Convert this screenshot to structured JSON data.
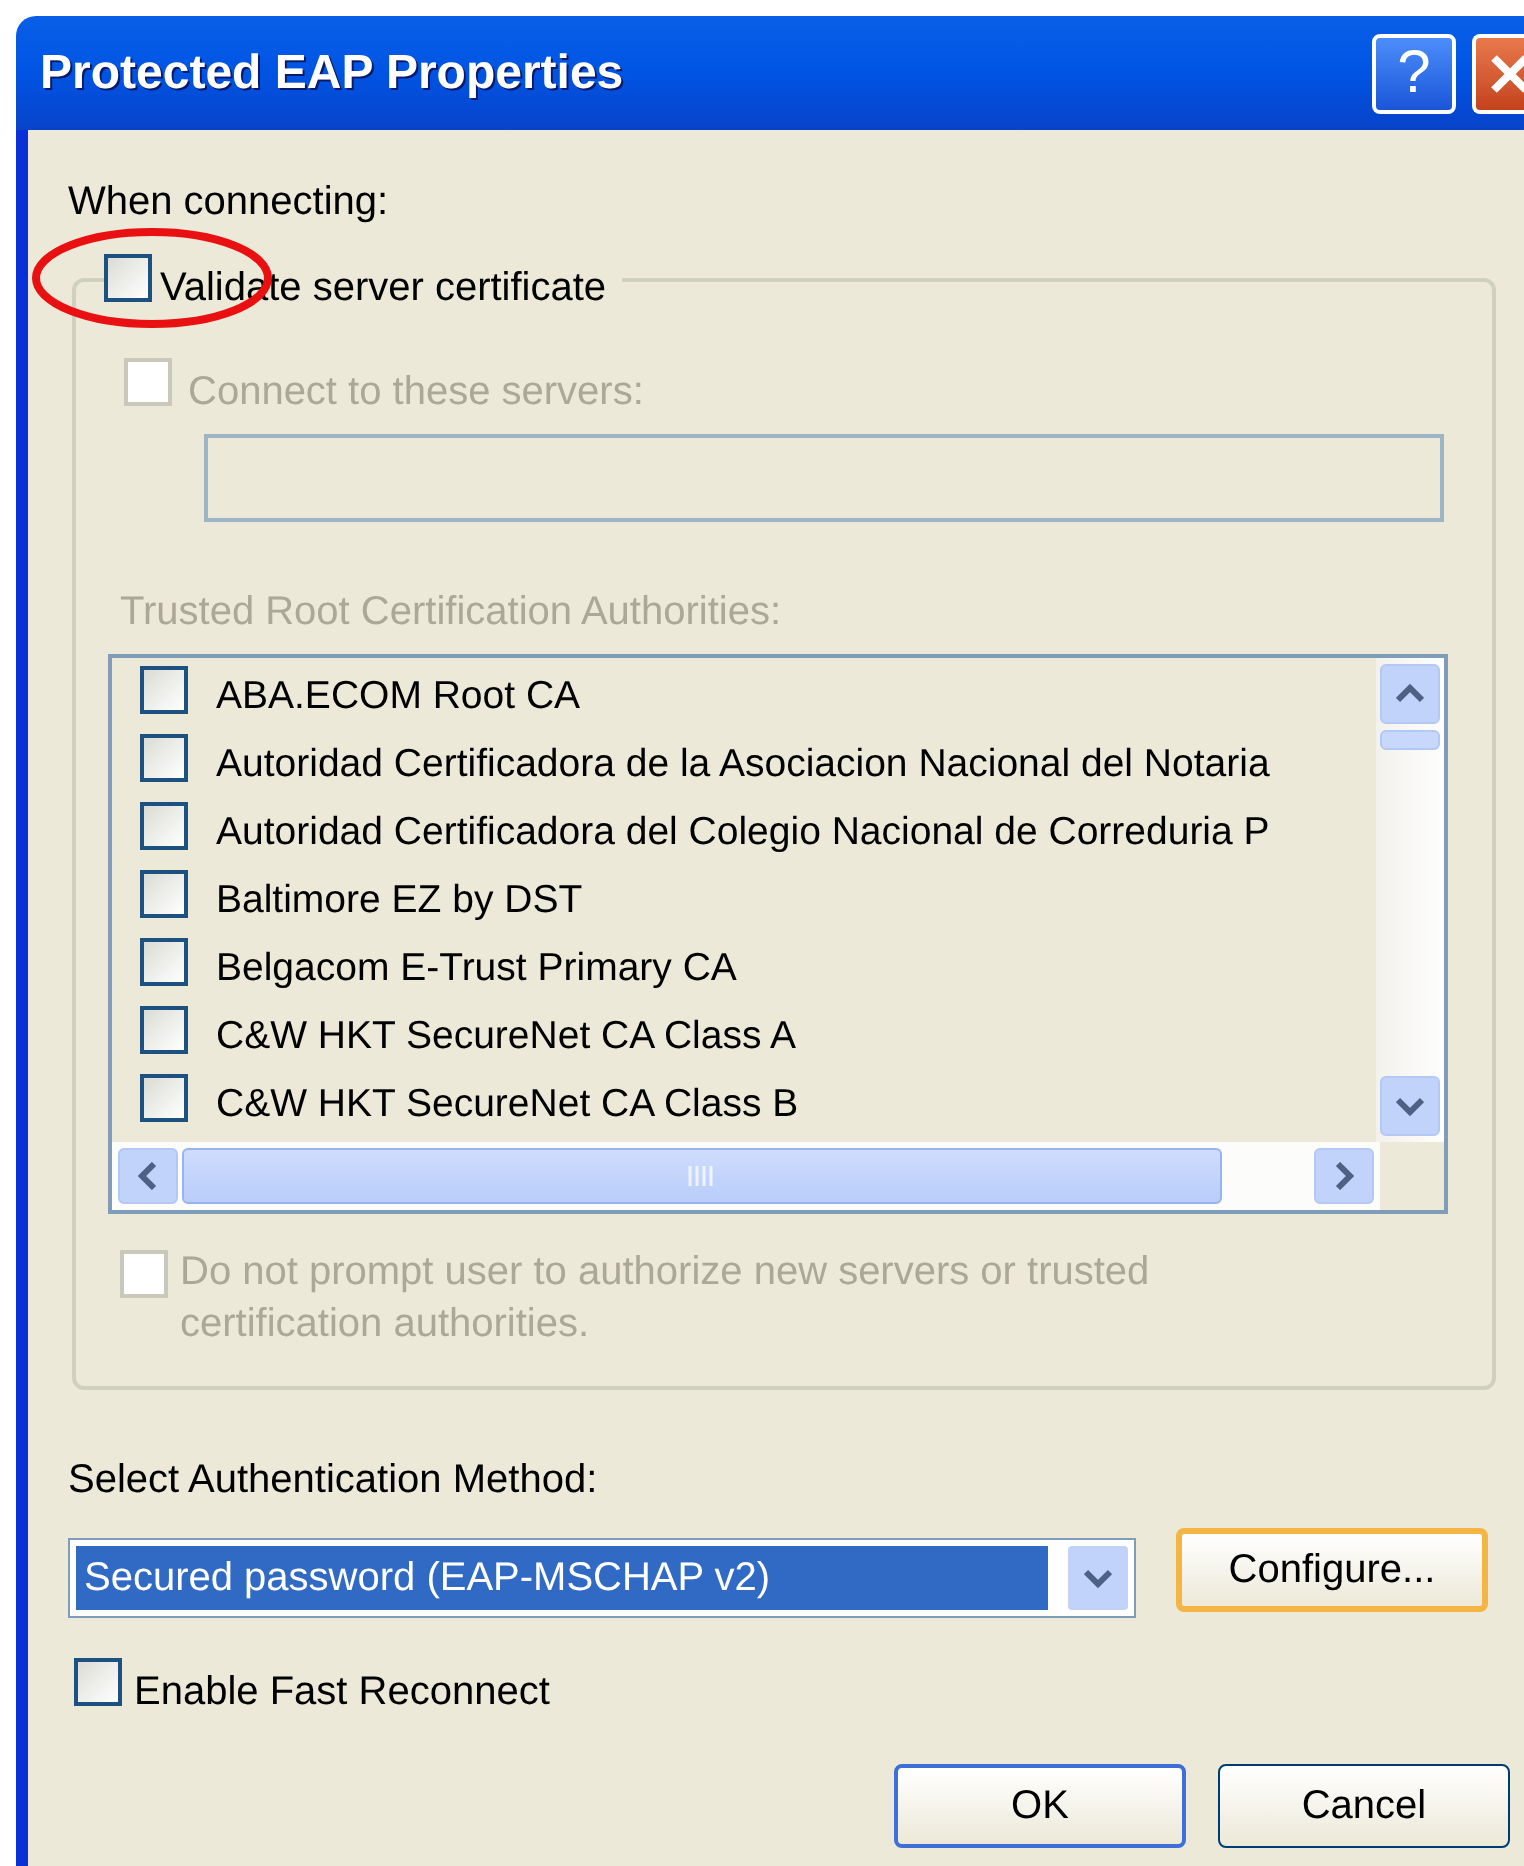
{
  "window": {
    "title": "Protected EAP Properties",
    "help_button": "?"
  },
  "when_connecting_label": "When connecting:",
  "validate_server_certificate": {
    "label": "Validate server certificate",
    "checked": false,
    "highlighted": true
  },
  "connect_to_servers": {
    "label": "Connect to these servers:",
    "checked": false,
    "disabled": true
  },
  "trusted_root_label": "Trusted Root Certification Authorities:",
  "certificate_list": [
    {
      "label": "ABA.ECOM Root CA",
      "checked": false
    },
    {
      "label": "Autoridad Certificadora de la Asociacion Nacional del Notaria",
      "checked": false
    },
    {
      "label": "Autoridad Certificadora del Colegio Nacional de Correduria P",
      "checked": false
    },
    {
      "label": "Baltimore EZ by DST",
      "checked": false
    },
    {
      "label": "Belgacom E-Trust Primary CA",
      "checked": false
    },
    {
      "label": "C&W HKT SecureNet CA Class A",
      "checked": false
    },
    {
      "label": "C&W HKT SecureNet CA Class B",
      "checked": false
    }
  ],
  "do_not_prompt": {
    "label": "Do not prompt user to authorize new servers or trusted certification authorities.",
    "checked": false,
    "disabled": true
  },
  "auth_method_label": "Select Authentication Method:",
  "auth_method": {
    "value": "Secured password (EAP-MSCHAP v2)"
  },
  "configure_button": {
    "label": "Configure...",
    "hot": true
  },
  "enable_fast_reconnect": {
    "label": "Enable Fast Reconnect",
    "checked": false
  },
  "buttons": [
    {
      "label": "OK",
      "default": true
    },
    {
      "label": "Cancel",
      "default": false
    }
  ]
}
